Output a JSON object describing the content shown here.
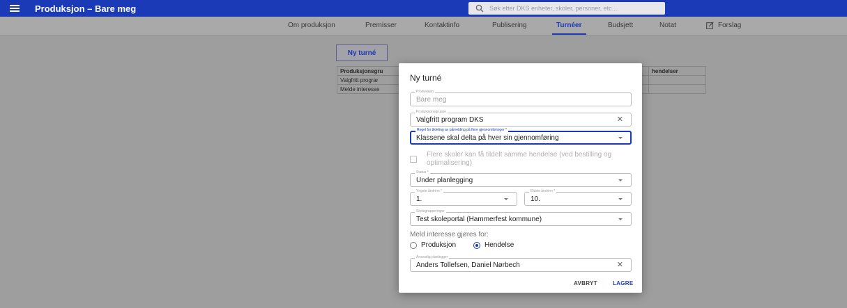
{
  "appbar": {
    "title": "Produksjon – Bare meg",
    "search_placeholder": "Søk etter DKS enheter, skoler, personer, etc...."
  },
  "tabs": [
    {
      "label": "Om produksjon",
      "active": false
    },
    {
      "label": "Premisser",
      "active": false
    },
    {
      "label": "Kontaktinfo",
      "active": false
    },
    {
      "label": "Publisering",
      "active": false
    },
    {
      "label": "Turnéer",
      "active": true
    },
    {
      "label": "Budsjett",
      "active": false
    },
    {
      "label": "Notat",
      "active": false
    },
    {
      "label": "Forslag",
      "active": false,
      "icon": "edit-box-icon"
    }
  ],
  "background": {
    "new_tour_button": "Ny turné",
    "table": {
      "headers": [
        "Produksjonsgru",
        "hendelser"
      ],
      "rows": [
        "Valgfritt prograr",
        "Melde interesse"
      ]
    }
  },
  "dialog": {
    "title": "Ny turné",
    "fields": {
      "produksjon": {
        "label": "Produksjon",
        "value": "Bare meg"
      },
      "produksjonsgruppe": {
        "label": "Produksjonsgruppe",
        "value": "Valgfritt program DKS"
      },
      "regel": {
        "label": "Regel for tildeling av påmelding på flere gjennomføringer *",
        "value": "Klassene skal delta på hver sin gjennomføring"
      },
      "status": {
        "label": "Status *",
        "value": "Under planlegging"
      },
      "yngste": {
        "label": "Yngste årstrinn *",
        "value": "1."
      },
      "eldste": {
        "label": "Eldste årstrinn *",
        "value": "10."
      },
      "skolegrupperinger": {
        "label": "Skolegrupperinger",
        "value": "Test skoleportal (Hammerfest kommune)"
      },
      "ansvarlig": {
        "label": "Ansvarlig planlegger",
        "value": "Anders Tollefsen, Daniel  Nørbech"
      }
    },
    "checkbox": {
      "label": "Flere skoler kan få tildelt samme hendelse (ved bestilling og optimalisering)",
      "checked": false
    },
    "radio": {
      "heading": "Meld interesse gjøres for:",
      "options": [
        {
          "label": "Produksjon",
          "selected": false
        },
        {
          "label": "Hendelse",
          "selected": true
        }
      ]
    },
    "actions": {
      "cancel": "AVBRYT",
      "save": "LAGRE"
    }
  },
  "colors": {
    "primary": "#1a3ab8",
    "overlay": "#9e9e9e"
  }
}
